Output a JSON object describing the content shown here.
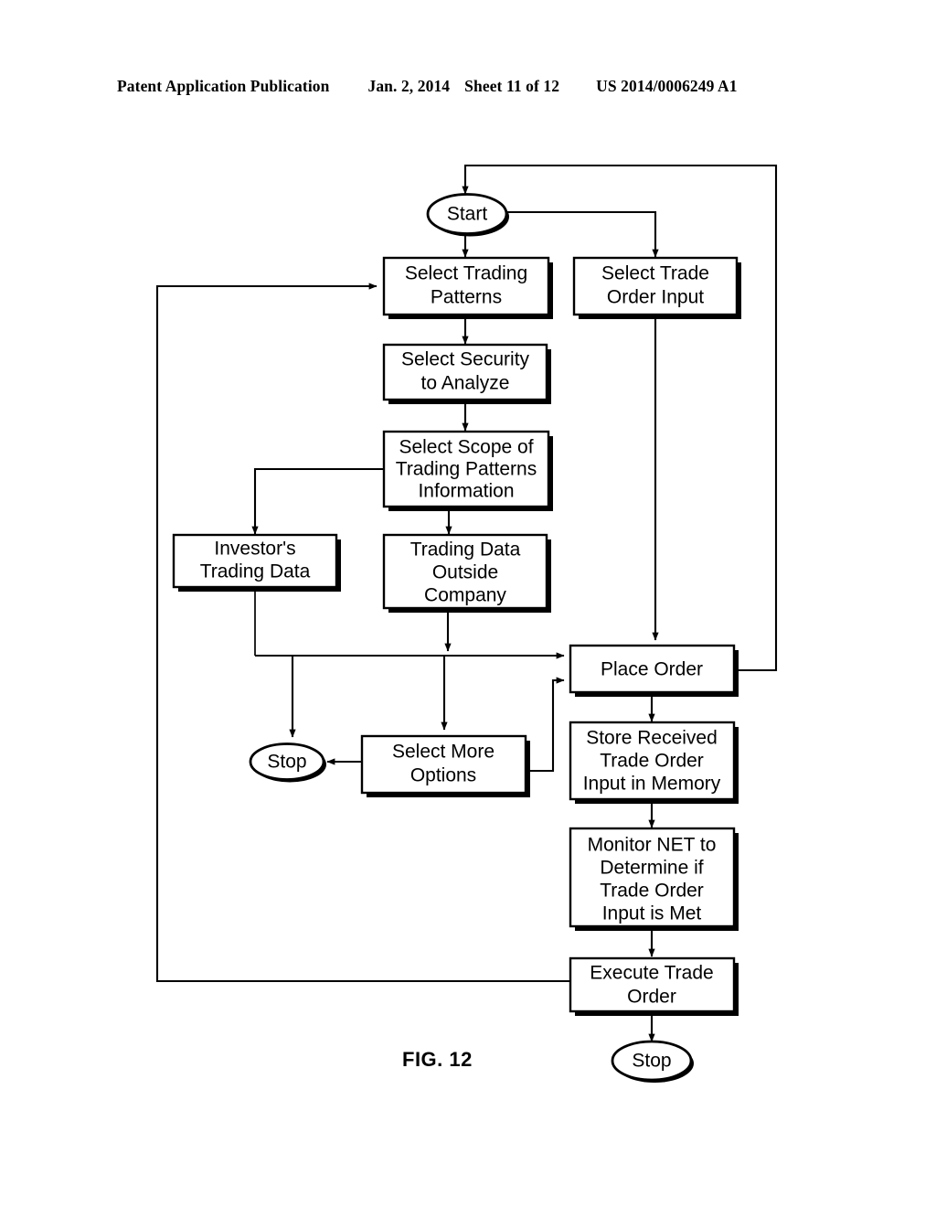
{
  "header": {
    "publication": "Patent Application Publication",
    "date": "Jan. 2, 2014",
    "sheet": "Sheet 11 of 12",
    "patent_number": "US 2014/0006249 A1"
  },
  "figure": {
    "label": "FIG. 12"
  },
  "colors": {
    "ink": "#000000",
    "paper": "#ffffff"
  },
  "nodes": {
    "start": {
      "label": "Start",
      "shape": "ellipse"
    },
    "select_trading_patterns": {
      "line1": "Select Trading",
      "line2": "Patterns",
      "shape": "rect"
    },
    "select_trade_order_input": {
      "line1": "Select Trade",
      "line2": "Order Input",
      "shape": "rect"
    },
    "select_security": {
      "line1": "Select Security",
      "line2": "to Analyze",
      "shape": "rect"
    },
    "select_scope": {
      "line1": "Select Scope of",
      "line2": "Trading Patterns",
      "line3": "Information",
      "shape": "rect"
    },
    "investors_trading_data": {
      "line1": "Investor's",
      "line2": "Trading Data",
      "shape": "rect"
    },
    "trading_data_outside": {
      "line1": "Trading Data",
      "line2": "Outside",
      "line3": "Company",
      "shape": "rect"
    },
    "place_order": {
      "line1": "Place Order",
      "shape": "rect"
    },
    "select_more_options": {
      "line1": "Select More",
      "line2": "Options",
      "shape": "rect"
    },
    "stop_left": {
      "label": "Stop",
      "shape": "ellipse"
    },
    "store_received": {
      "line1": "Store Received",
      "line2": "Trade Order",
      "line3": "Input in Memory",
      "shape": "rect"
    },
    "monitor_net": {
      "line1": "Monitor NET to",
      "line2": "Determine if",
      "line3": "Trade Order",
      "line4": "Input is Met",
      "shape": "rect"
    },
    "execute_trade_order": {
      "line1": "Execute Trade",
      "line2": "Order",
      "shape": "rect"
    },
    "stop_bottom": {
      "label": "Stop",
      "shape": "ellipse"
    }
  },
  "edges": [
    {
      "from": "feedback-top",
      "to": "start",
      "kind": "arrow"
    },
    {
      "from": "start",
      "to": "select_trading_patterns",
      "kind": "arrow"
    },
    {
      "from": "start",
      "to": "select_trade_order_input",
      "kind": "arrow"
    },
    {
      "from": "select_trading_patterns",
      "to": "select_security",
      "kind": "arrow"
    },
    {
      "from": "select_security",
      "to": "select_scope",
      "kind": "arrow"
    },
    {
      "from": "select_scope",
      "to": "investors_trading_data",
      "kind": "arrow"
    },
    {
      "from": "select_scope",
      "to": "trading_data_outside",
      "kind": "arrow"
    },
    {
      "from": "investors_trading_data",
      "to": "place_order",
      "kind": "arrow"
    },
    {
      "from": "investors_trading_data",
      "to": "stop_left",
      "kind": "arrow"
    },
    {
      "from": "trading_data_outside",
      "to": "place_order",
      "kind": "arrow"
    },
    {
      "from": "trading_data_outside",
      "to": "select_more_options",
      "kind": "arrow"
    },
    {
      "from": "select_more_options",
      "to": "stop_left",
      "kind": "arrow"
    },
    {
      "from": "select_more_options",
      "to": "place_order",
      "kind": "arrow"
    },
    {
      "from": "select_trade_order_input",
      "to": "place_order",
      "kind": "arrow"
    },
    {
      "from": "place_order",
      "to": "store_received",
      "kind": "arrow"
    },
    {
      "from": "place_order",
      "to": "feedback-top",
      "kind": "line"
    },
    {
      "from": "store_received",
      "to": "monitor_net",
      "kind": "arrow"
    },
    {
      "from": "monitor_net",
      "to": "execute_trade_order",
      "kind": "arrow"
    },
    {
      "from": "execute_trade_order",
      "to": "stop_bottom",
      "kind": "arrow"
    },
    {
      "from": "execute_trade_order",
      "to": "select_trading_patterns",
      "kind": "arrow"
    }
  ]
}
